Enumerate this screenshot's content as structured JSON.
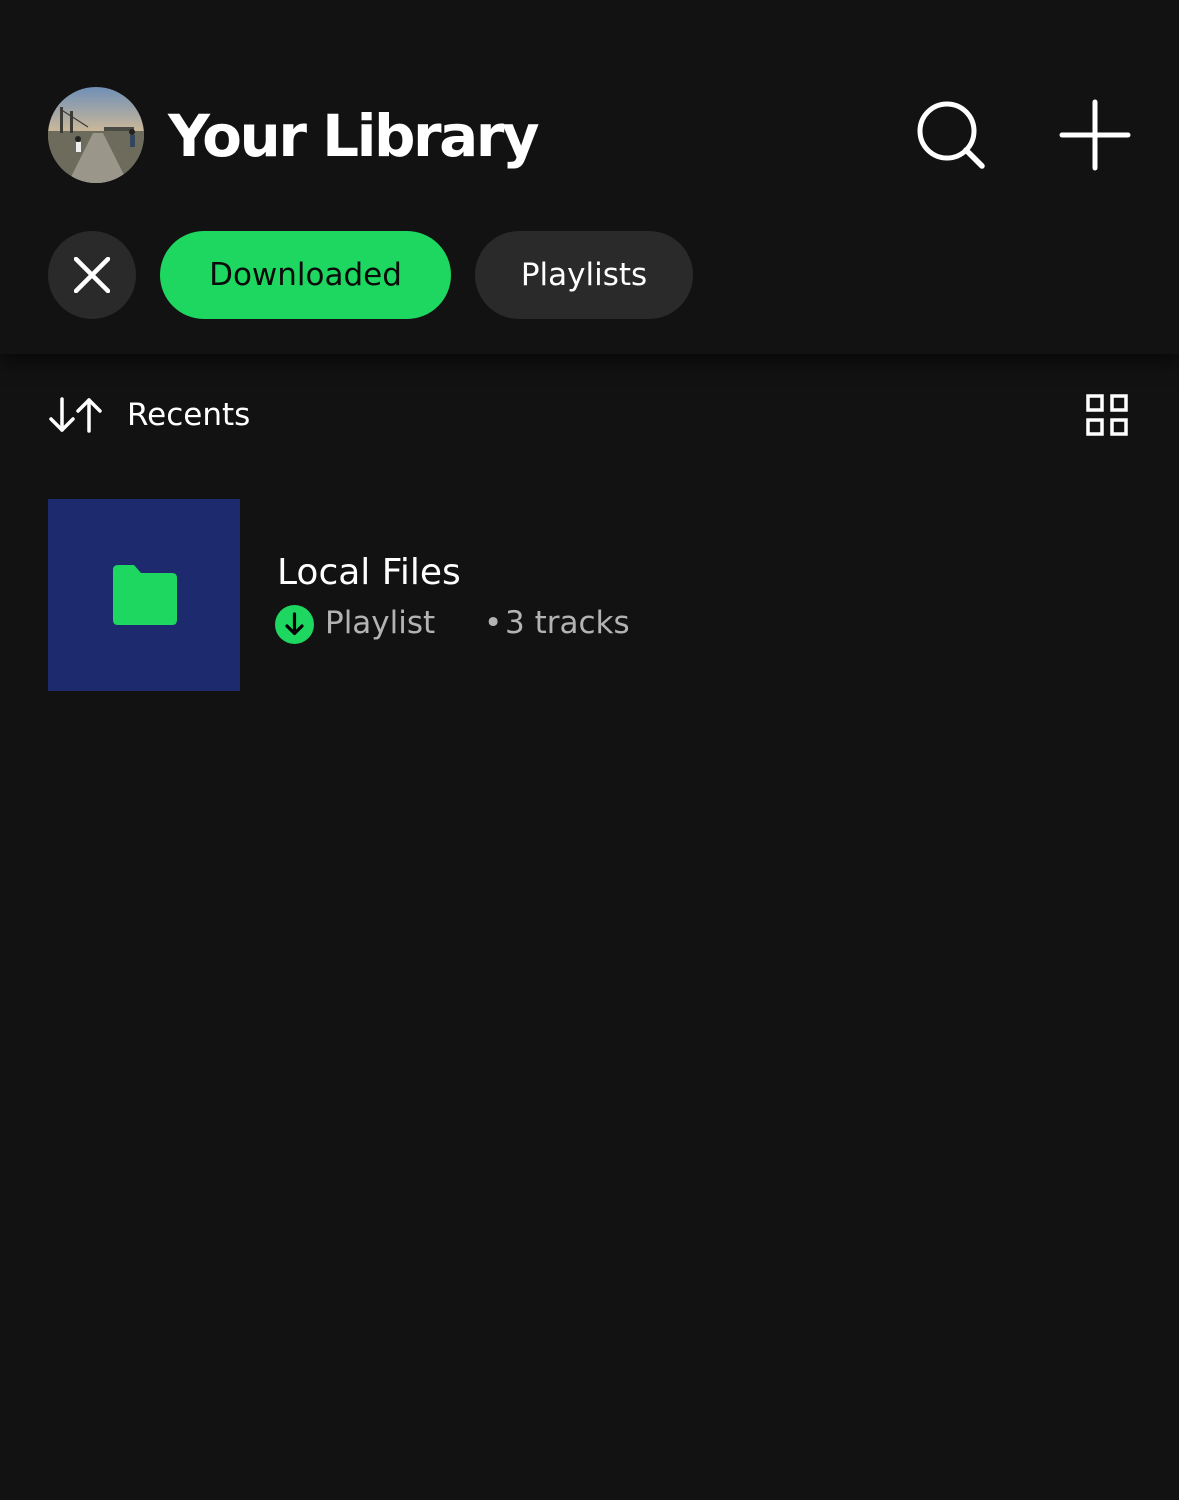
{
  "header": {
    "title": "Your Library",
    "avatar_icon": "user-avatar-photo",
    "search_icon": "search-icon",
    "add_icon": "plus-icon"
  },
  "filters": {
    "clear_icon": "close-icon",
    "chips": [
      {
        "label": "Downloaded",
        "selected": true
      },
      {
        "label": "Playlists",
        "selected": false
      }
    ]
  },
  "sort": {
    "label": "Recents",
    "icon": "sort-arrows-icon",
    "view_toggle_icon": "grid-view-icon"
  },
  "items": [
    {
      "title": "Local Files",
      "type": "Playlist",
      "separator": "•",
      "count": "3 tracks",
      "downloaded": true,
      "art_icon": "folder-icon"
    }
  ],
  "colors": {
    "background": "#121212",
    "accent": "#1ed760",
    "chip_bg": "#2a2a2a",
    "art_bg": "#1e2a6e",
    "secondary_text": "#b3b3b3"
  }
}
